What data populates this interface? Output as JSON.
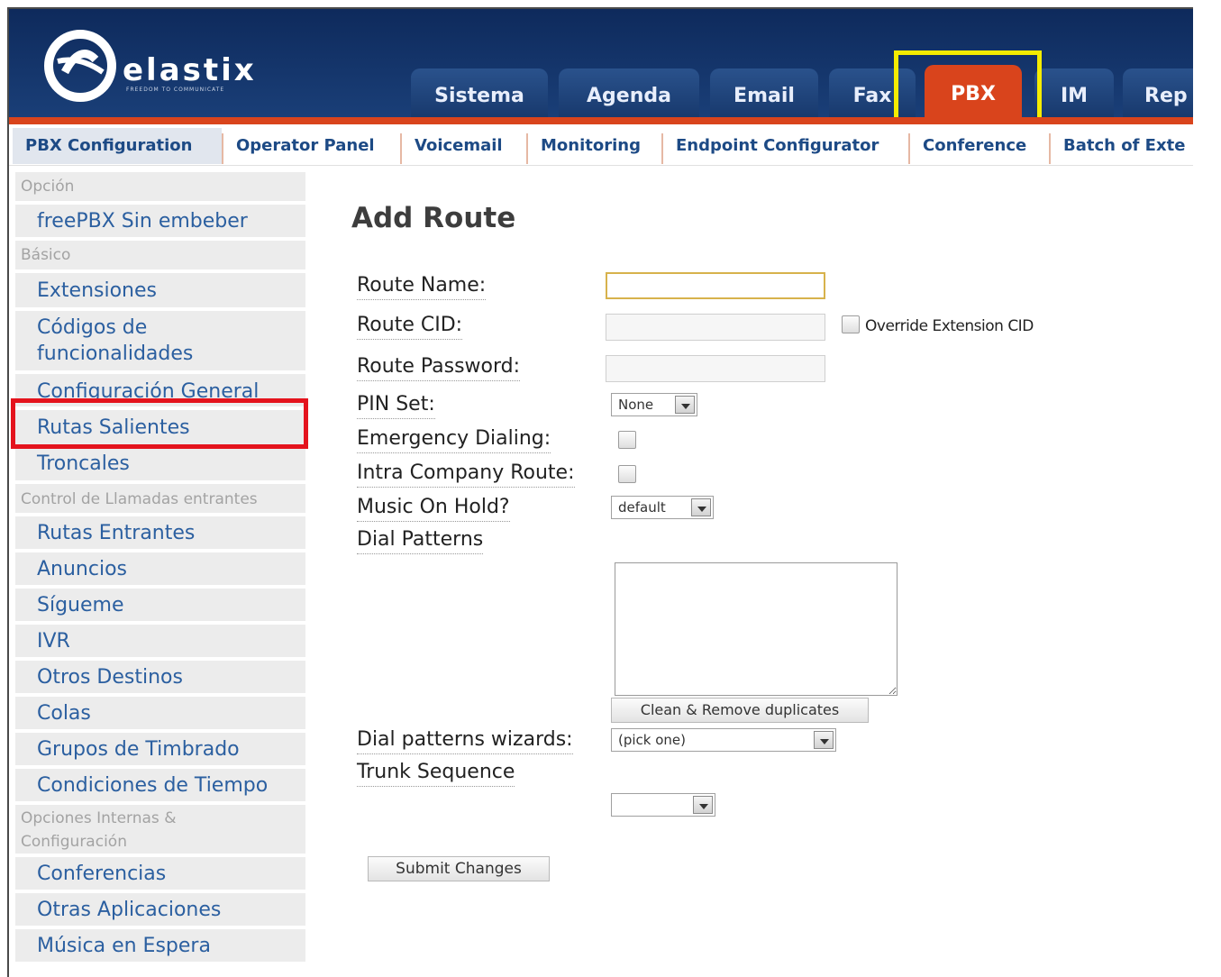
{
  "header": {
    "logo_text": "elastix",
    "logo_tagline": "FREEDOM TO COMMUNICATE",
    "tabs": [
      "Sistema",
      "Agenda",
      "Email",
      "Fax",
      "PBX",
      "IM",
      "Rep"
    ],
    "active_tab": "PBX"
  },
  "subtabs": [
    "PBX Configuration",
    "Operator Panel",
    "Voicemail",
    "Monitoring",
    "Endpoint Configurator",
    "Conference",
    "Batch of Exte"
  ],
  "sidebar": {
    "items": [
      {
        "type": "head",
        "label": "Opción"
      },
      {
        "type": "link",
        "label": "freePBX Sin embeber"
      },
      {
        "type": "head",
        "label": "Básico"
      },
      {
        "type": "link",
        "label": "Extensiones"
      },
      {
        "type": "link",
        "label": "Códigos de funcionalidades"
      },
      {
        "type": "link",
        "label": "Configuración General"
      },
      {
        "type": "link",
        "label": "Rutas Salientes"
      },
      {
        "type": "link",
        "label": "Troncales"
      },
      {
        "type": "head",
        "label": "Control de Llamadas entrantes"
      },
      {
        "type": "link",
        "label": "Rutas Entrantes"
      },
      {
        "type": "link",
        "label": "Anuncios"
      },
      {
        "type": "link",
        "label": "Sígueme"
      },
      {
        "type": "link",
        "label": "IVR"
      },
      {
        "type": "link",
        "label": "Otros Destinos"
      },
      {
        "type": "link",
        "label": "Colas"
      },
      {
        "type": "link",
        "label": "Grupos de Timbrado"
      },
      {
        "type": "link",
        "label": "Condiciones de Tiempo"
      },
      {
        "type": "head",
        "label": "Opciones Internas & Configuración"
      },
      {
        "type": "link",
        "label": "Conferencias"
      },
      {
        "type": "link",
        "label": "Otras Aplicaciones"
      },
      {
        "type": "link",
        "label": "Música en Espera"
      }
    ],
    "highlighted": "Rutas Salientes"
  },
  "form": {
    "title": "Add Route",
    "route_name_label": "Route Name:",
    "route_name_value": "",
    "route_cid_label": "Route CID:",
    "route_cid_value": "",
    "override_cid_label": "Override Extension CID",
    "override_cid_checked": false,
    "route_password_label": "Route Password:",
    "route_password_value": "",
    "pin_set_label": "PIN Set:",
    "pin_set_value": "None",
    "emergency_label": "Emergency Dialing:",
    "emergency_checked": false,
    "intra_label": "Intra Company Route:",
    "intra_checked": false,
    "moh_label": "Music On Hold?",
    "moh_value": "default",
    "dial_patterns_label": "Dial Patterns",
    "dial_patterns_value": "",
    "clean_button": "Clean & Remove duplicates",
    "wizards_label": "Dial patterns wizards:",
    "wizards_value": "(pick one)",
    "trunk_label": "Trunk Sequence",
    "trunk_value": "",
    "submit_button": "Submit Changes"
  }
}
